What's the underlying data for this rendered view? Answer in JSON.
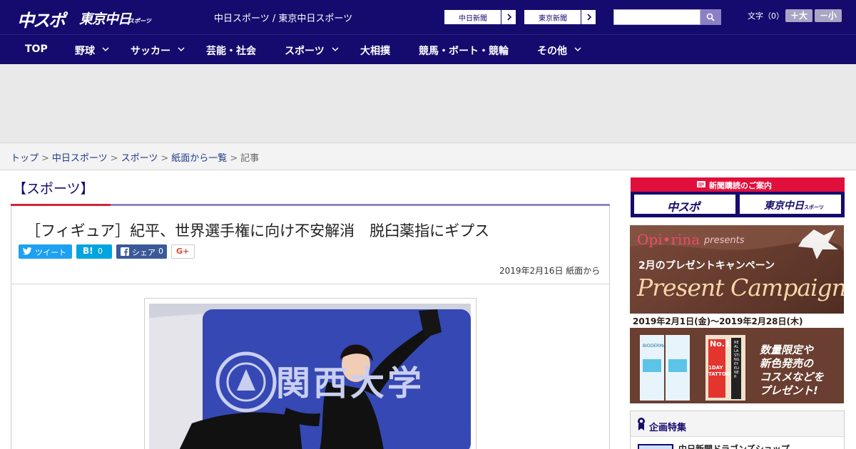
{
  "header": {
    "logo_text_1": "中スポ",
    "logo_text_2": "東京中日",
    "logo_text_3": "スポーツ",
    "site_name": "中日スポーツ / 東京中日スポーツ",
    "ext_links": [
      {
        "label": "中日新聞"
      },
      {
        "label": "東京新聞"
      }
    ],
    "search": {
      "value": "",
      "placeholder": ""
    },
    "font_size_label": "文字（0）",
    "font_larger": "＋大",
    "font_smaller": "－小",
    "colors": {
      "brand": "#150b6e",
      "accent_red": "#d0253a"
    }
  },
  "nav": {
    "items": [
      {
        "label": "TOP"
      },
      {
        "label": "野球"
      },
      {
        "label": "サッカー"
      },
      {
        "label": "芸能・社会"
      },
      {
        "label": "スポーツ"
      },
      {
        "label": "大相撲"
      },
      {
        "label": "競馬・ボート・競輪"
      },
      {
        "label": "その他"
      }
    ]
  },
  "breadcrumb": {
    "items": [
      "トップ",
      "中日スポーツ",
      "スポーツ",
      "紙面から一覧"
    ],
    "current": "記事",
    "separator": ">"
  },
  "article": {
    "category": "【スポーツ】",
    "headline": "［フィギュア］紀平、世界選手権に向け不安解消　脱臼薬指にギプス",
    "share": {
      "tweet": "ツイート",
      "hatena_mark": "B!",
      "hatena_count": "0",
      "facebook": "シェア",
      "facebook_count": "0",
      "gplus": "G+"
    },
    "dateline": "2019年2月16日 紙面から",
    "photo_text": "関西大学"
  },
  "sidebar": {
    "subscribe_header": "新聞購読のご案内",
    "subscribe_logos": [
      "中スポ",
      "東京中日",
      "スポーツ"
    ],
    "promo": {
      "brand": "Opi•rina",
      "presents": "presents",
      "title_jp": "2月のプレゼントキャンペーン",
      "title_en": "Present Campaign",
      "dates": "2019年2月1日(金)～2019年2月28日(木)",
      "badge": "No.1",
      "product_1": "BIODERMA",
      "product_2": "1DAY TATTOO",
      "product_3": "REAL LASTING EYELINER",
      "copy": [
        "数量限定や",
        "新色発売の",
        "コスメなどを",
        "プレゼント!"
      ]
    },
    "feature": {
      "heading": "企画特集",
      "item": "中日新聞ドラゴンズショップ"
    }
  }
}
